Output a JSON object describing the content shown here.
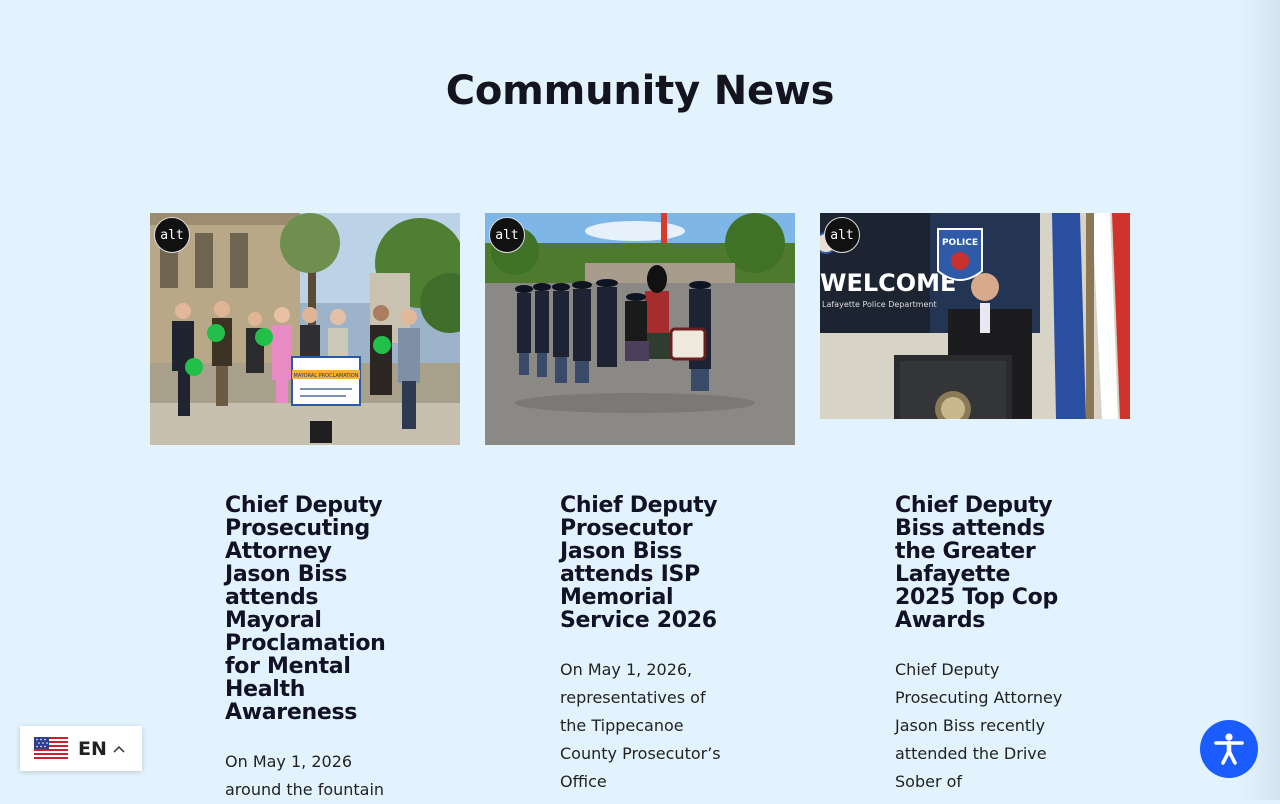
{
  "section": {
    "title": "Community News"
  },
  "cards": [
    {
      "alt_label": "alt",
      "title": "Chief Deputy Prosecuting Attorney Jason Biss attends Mayoral Proclamation for Mental Health Awareness",
      "excerpt": "On May 1, 2026 around the fountain",
      "image_sign_text": "MAYORAL PROCLAMATION"
    },
    {
      "alt_label": "alt",
      "title": "Chief Deputy Prosecutor Jason Biss attends ISP Memorial Service 2026",
      "excerpt": "On May 1, 2026, representatives of the Tippecanoe County Prosecutor’s Office"
    },
    {
      "alt_label": "alt",
      "title": "Chief Deputy Biss attends the Greater Lafayette 2025 Top Cop Awards",
      "excerpt": "Chief Deputy Prosecuting Attorney Jason Biss recently attended the Drive Sober of",
      "image_screen_text": "WELCOME",
      "image_screen_subtext": "Lafayette Police Department",
      "image_badge_text": "POLICE"
    }
  ],
  "language": {
    "code": "EN"
  },
  "colors": {
    "background": "#e3f3fd",
    "accent": "#1a5cff"
  },
  "icons": {
    "language_flag": "us-flag-icon",
    "chevron": "chevron-up-icon",
    "accessibility": "accessibility-icon"
  }
}
